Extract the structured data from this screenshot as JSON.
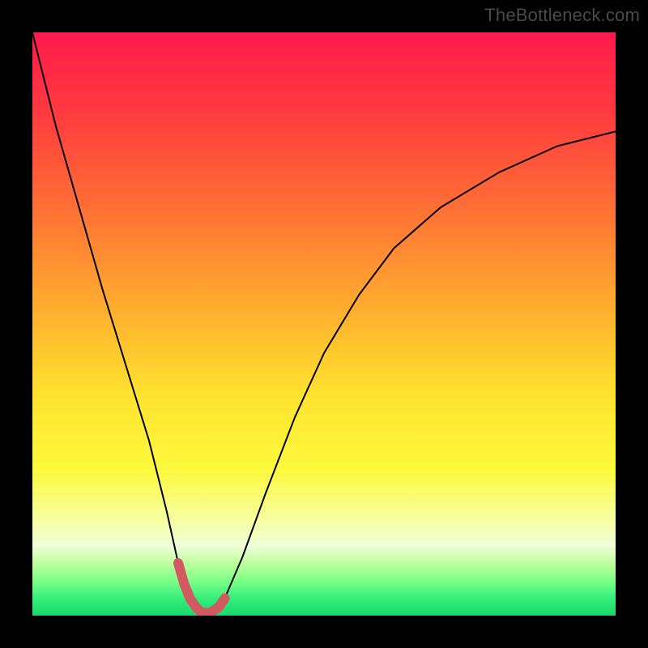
{
  "watermark": "TheBottleneck.com",
  "colors": {
    "gradient_stops": [
      {
        "pct": 0,
        "color": "#ff1a4b"
      },
      {
        "pct": 14,
        "color": "#ff3b3f"
      },
      {
        "pct": 30,
        "color": "#ff6f35"
      },
      {
        "pct": 48,
        "color": "#ffb02e"
      },
      {
        "pct": 62,
        "color": "#ffe22f"
      },
      {
        "pct": 75,
        "color": "#fcf93d"
      },
      {
        "pct": 84,
        "color": "#f6ffa6"
      },
      {
        "pct": 88,
        "color": "#f0ffd9"
      },
      {
        "pct": 91,
        "color": "#bfff9e"
      },
      {
        "pct": 94,
        "color": "#7dff88"
      },
      {
        "pct": 97,
        "color": "#34f07a"
      },
      {
        "pct": 100,
        "color": "#19d96d"
      }
    ],
    "curve_main": "#000000",
    "curve_highlight": "#d15a62",
    "frame": "#000000"
  },
  "chart_data": {
    "type": "line",
    "title": "",
    "xlabel": "",
    "ylabel": "",
    "xlim": [
      0,
      100
    ],
    "ylim": [
      0,
      100
    ],
    "grid": false,
    "legend": false,
    "annotations": [
      {
        "text": "TheBottleneck.com",
        "pos": "top-right"
      }
    ],
    "series": [
      {
        "name": "bottleneck-curve",
        "x": [
          0,
          4,
          8,
          12,
          16,
          20,
          23,
          25,
          27,
          29,
          30.5,
          33,
          36,
          40,
          45,
          50,
          56,
          62,
          70,
          80,
          90,
          100
        ],
        "y": [
          100,
          84,
          70,
          56,
          43,
          30,
          18,
          9,
          3,
          0.5,
          0.5,
          3,
          10,
          21,
          34,
          45,
          55,
          63,
          70,
          76,
          80.5,
          83
        ],
        "color": "#000000",
        "stroke_width": 2
      },
      {
        "name": "optimal-range-highlight",
        "x": [
          25,
          26,
          27,
          28,
          29,
          30.5,
          32,
          33
        ],
        "y": [
          9,
          5.5,
          3,
          1.5,
          0.5,
          0.5,
          1.5,
          3
        ],
        "color": "#d15a62",
        "stroke_width": 12
      }
    ],
    "optimal_x_range": [
      25,
      33
    ],
    "minimum_point": {
      "x": 29.7,
      "y": 0.5
    }
  }
}
